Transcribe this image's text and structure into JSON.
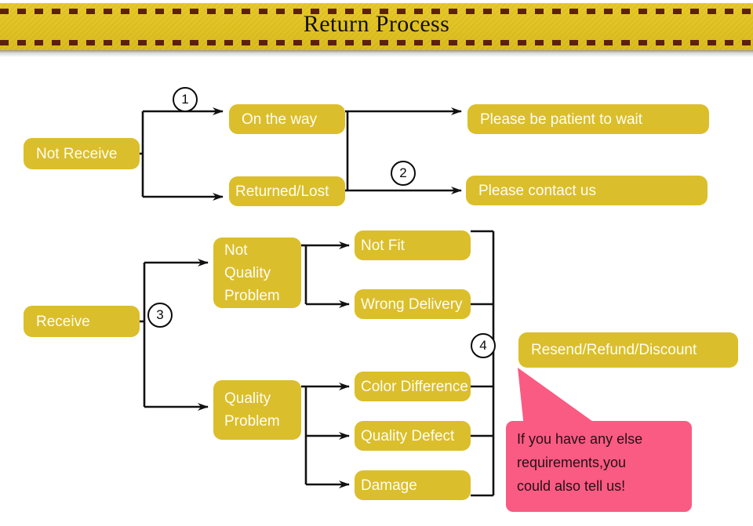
{
  "header": {
    "title": "Return Process",
    "ribbon_color": "#e0c120",
    "dash_color": "#5c1f10"
  },
  "theme": {
    "node_fill": "#dbbe2b",
    "node_text": "#fdfdf5",
    "connector": "#111111",
    "callout_fill": "#fa5b82",
    "callout_text": "#231016"
  },
  "flow": {
    "roots": [
      {
        "id": "not-receive",
        "label": "Not Receive"
      },
      {
        "id": "receive",
        "label": "Receive"
      }
    ],
    "stage_two": [
      {
        "id": "on-the-way",
        "label": "On the way"
      },
      {
        "id": "returned-lost",
        "label": "Returned/Lost"
      },
      {
        "id": "not-quality-problem",
        "label": "Not\nQuality\nProblem"
      },
      {
        "id": "quality-problem",
        "label": "Quality\nProblem"
      }
    ],
    "outcomes_top": [
      {
        "id": "be-patient",
        "label": "Please be patient to wait"
      },
      {
        "id": "contact-us",
        "label": "Please contact us"
      }
    ],
    "reasons": [
      {
        "id": "not-fit",
        "label": "Not Fit"
      },
      {
        "id": "wrong-delivery",
        "label": "Wrong Delivery"
      },
      {
        "id": "color-difference",
        "label": "Color Difference"
      },
      {
        "id": "quality-defect",
        "label": "Quality Defect"
      },
      {
        "id": "damage",
        "label": "Damage"
      }
    ],
    "final_outcome": {
      "id": "resend-refund-discount",
      "label": "Resend/Refund/Discount"
    },
    "step_markers": [
      {
        "id": "step-1",
        "label": "1"
      },
      {
        "id": "step-2",
        "label": "2"
      },
      {
        "id": "step-3",
        "label": "3"
      },
      {
        "id": "step-4",
        "label": "4"
      }
    ]
  },
  "callout": {
    "text": "If you have any else\nrequirements,you\ncould also tell us!"
  }
}
